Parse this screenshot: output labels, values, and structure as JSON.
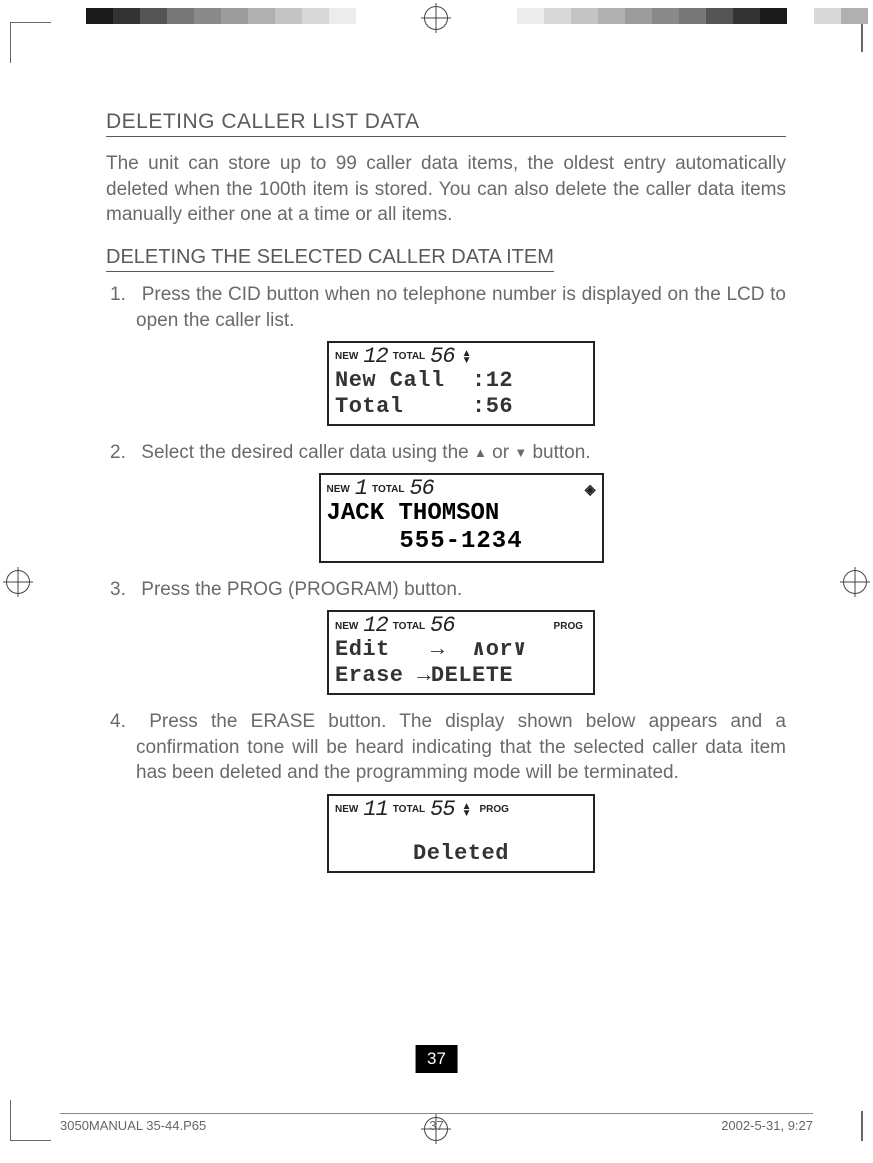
{
  "registration": {
    "swatches_left": [
      "#1a1a1a",
      "#333333",
      "#555555",
      "#777777",
      "#8a8a8a",
      "#9c9c9c",
      "#b0b0b0",
      "#c4c4c4",
      "#d8d8d8",
      "#ececec",
      "#ffffff"
    ],
    "swatches_right": [
      "#ffffff",
      "#ececec",
      "#d8d8d8",
      "#c4c4c4",
      "#b0b0b0",
      "#9c9c9c",
      "#8a8a8a",
      "#777777",
      "#555555",
      "#333333",
      "#1a1a1a",
      "#ffffff",
      "#d8d8d8",
      "#b0b0b0"
    ]
  },
  "headings": {
    "main": "DELETING CALLER LIST DATA",
    "sub": "DELETING THE SELECTED CALLER DATA ITEM"
  },
  "intro": "The unit can store up to 99 caller data items, the oldest entry automatically deleted when the 100th item is stored. You can also delete the caller data items manually either one at a time or all items.",
  "steps": [
    {
      "text": "Press the CID button when no telephone number is displayed on the LCD to open the caller list."
    },
    {
      "text_pre": "Select the desired caller data using the ",
      "text_mid": " or ",
      "text_post": " button."
    },
    {
      "text": "Press the PROG (PROGRAM) button."
    },
    {
      "text": "Press the ERASE button. The display shown below appears and a confirmation tone will be heard indicating that the selected caller data item has been deleted and the programming mode will be terminated."
    }
  ],
  "lcd": {
    "s1": {
      "new_label": "NEW",
      "new_count": "12",
      "total_label": "TOTAL",
      "total_count": "56",
      "show_arrows": true,
      "line1": "New Call  :12",
      "line2": "Total     :56"
    },
    "s2": {
      "new_label": "NEW",
      "new_count": "1",
      "total_label": "TOTAL",
      "total_count": "56",
      "diamond": true,
      "line1": "JACK THOMSON",
      "line2": "555-1234"
    },
    "s3": {
      "new_label": "NEW",
      "new_count": "12",
      "total_label": "TOTAL",
      "total_count": "56",
      "prog_label": "PROG",
      "line1": "Edit   →  ∧or∨",
      "line2": "Erase →DELETE"
    },
    "s4": {
      "new_label": "NEW",
      "new_count": "11",
      "total_label": "TOTAL",
      "total_count": "55",
      "show_arrows": true,
      "prog_label": "PROG",
      "line2": "Deleted"
    }
  },
  "page_number": "37",
  "footer": {
    "file": "3050MANUAL 35-44.P65",
    "page": "37",
    "date": "2002-5-31, 9:27"
  }
}
